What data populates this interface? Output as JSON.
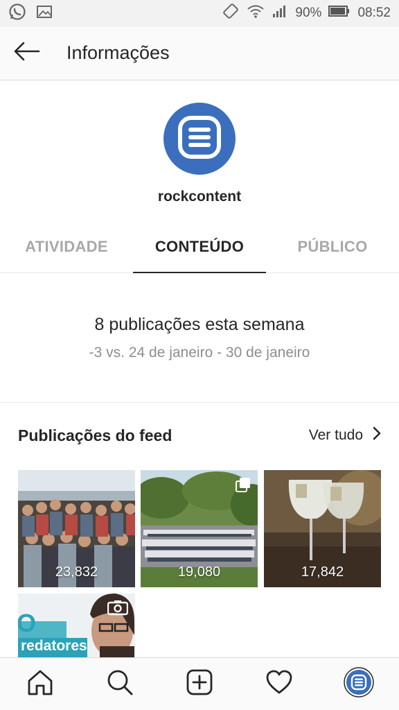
{
  "status_bar": {
    "left_icons": [
      "whatsapp-icon",
      "gallery-icon"
    ],
    "right_icons": [
      "vibrate-icon",
      "wifi-icon",
      "signal-icon",
      "battery-icon"
    ],
    "battery": "90%",
    "time": "08:52"
  },
  "header": {
    "back_icon": "arrow-left-icon",
    "title": "Informações"
  },
  "profile": {
    "avatar_icon": "rockcontent-logo",
    "username": "rockcontent",
    "brand_color": "#3b6fbd"
  },
  "tabs": [
    {
      "label": "ATIVIDADE",
      "active": false
    },
    {
      "label": "CONTEÚDO",
      "active": true
    },
    {
      "label": "PÚBLICO",
      "active": false
    }
  ],
  "summary": {
    "title": "8 publicações esta semana",
    "subtitle": "-3 vs. 24 de janeiro - 30 de janeiro"
  },
  "feed": {
    "title": "Publicações do feed",
    "see_all": "Ver tudo",
    "see_all_icon": "chevron-right-icon",
    "posts": [
      {
        "count": "23,832",
        "image": "team-group-photo"
      },
      {
        "count": "19,080",
        "image": "crowd-outdoor-photo",
        "multiple": true
      },
      {
        "count": "17,842",
        "image": "glasses-drink-photo"
      },
      {
        "count": "",
        "image": "video-redatores",
        "overlay_text": "redatores",
        "overlay_big": "O",
        "video": true
      }
    ]
  },
  "bottom_nav": [
    "home-icon",
    "search-icon",
    "add-post-icon",
    "activity-heart-icon",
    "profile-avatar-icon"
  ]
}
